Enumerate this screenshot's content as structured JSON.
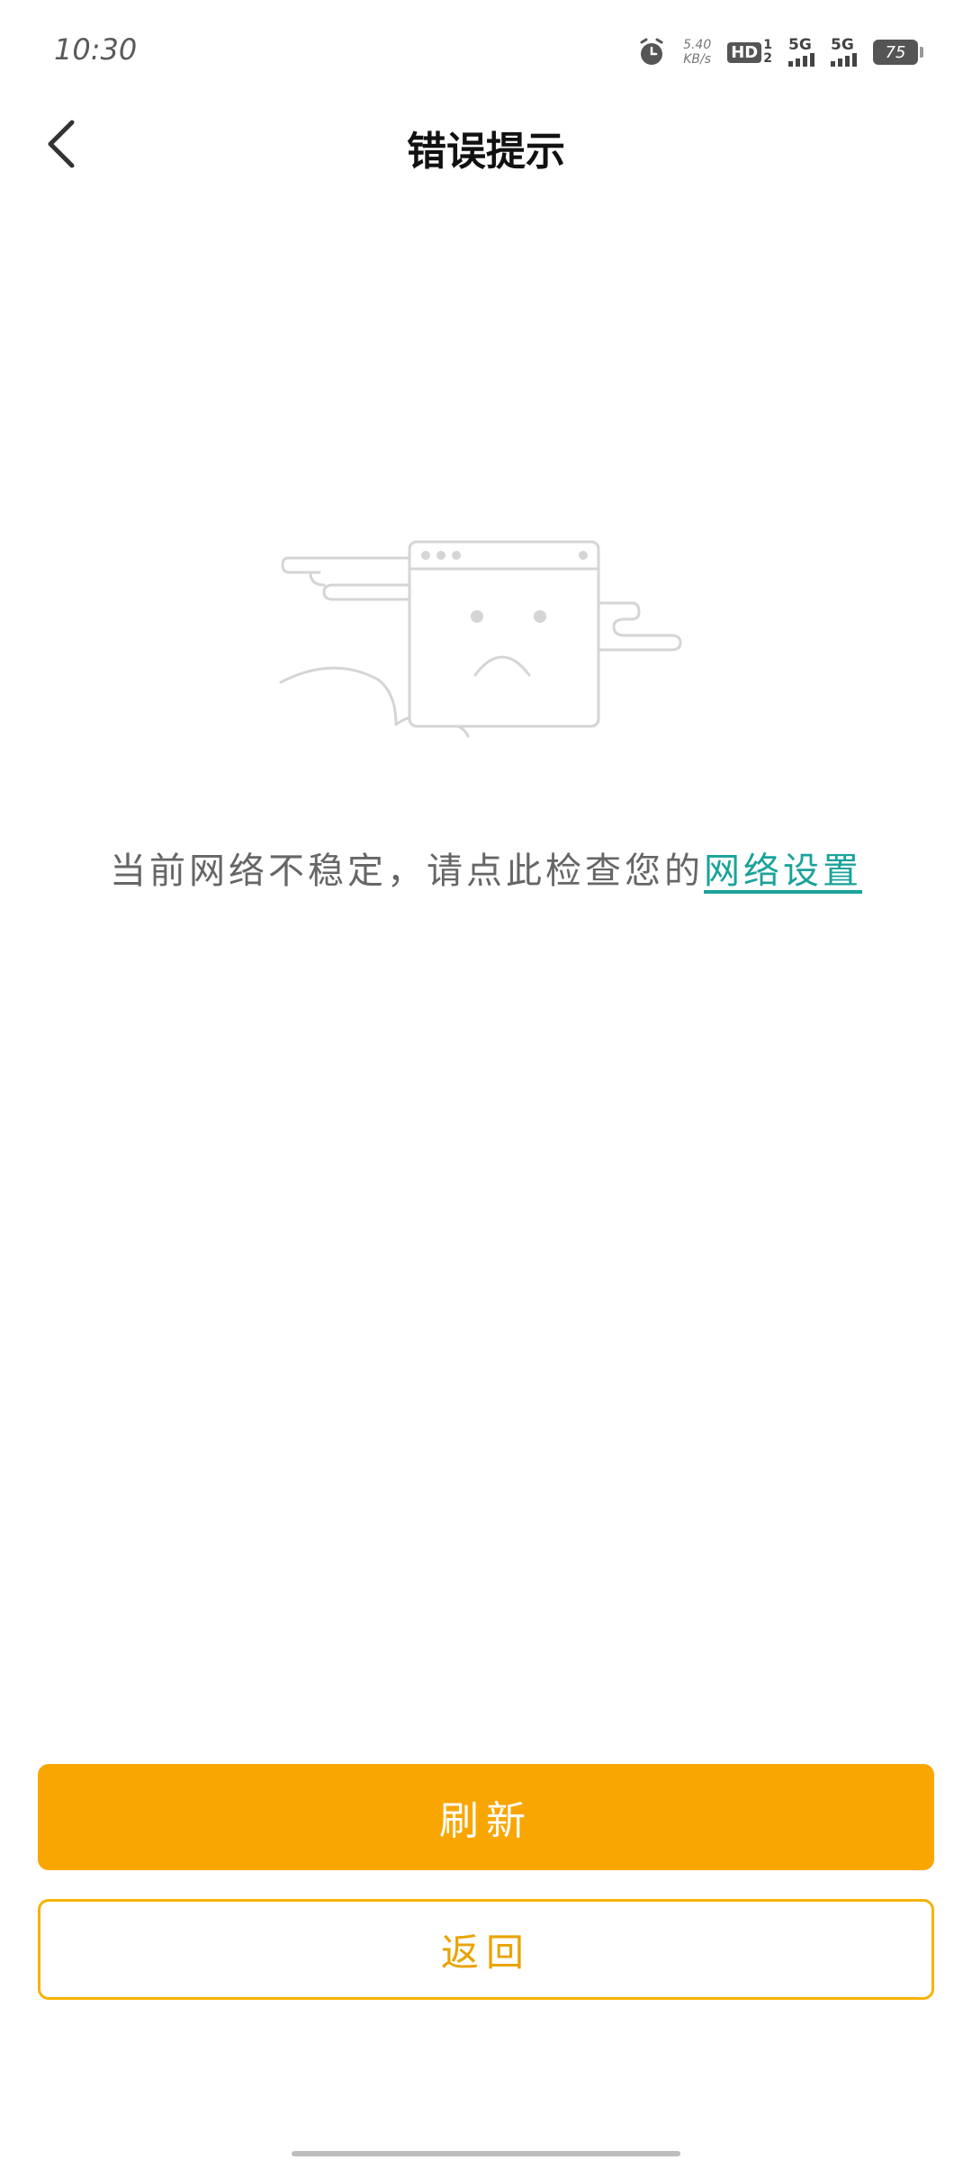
{
  "status_bar": {
    "time": "10:30",
    "net_speed_value": "5.40",
    "net_speed_unit": "KB/s",
    "hd_label": "HD",
    "hd_sim_top": "1",
    "hd_sim_bottom": "2",
    "signal1_label": "5G",
    "signal2_label": "5G",
    "battery": "75",
    "icons": [
      "alarm-icon",
      "hd-icon",
      "signal-icon",
      "signal-icon",
      "battery-icon"
    ]
  },
  "header": {
    "title": "错误提示",
    "back_icon": "chevron-left-icon"
  },
  "illustration": {
    "icon": "sad-browser-window-icon"
  },
  "message": {
    "text": "当前网络不稳定，请点此检查您的",
    "link": "网络设置"
  },
  "buttons": {
    "refresh_label": "刷新",
    "back_label": "返回"
  },
  "colors": {
    "accent": "#f9a602",
    "link": "#1aa39a",
    "illustration_stroke": "#d5d5d5"
  }
}
